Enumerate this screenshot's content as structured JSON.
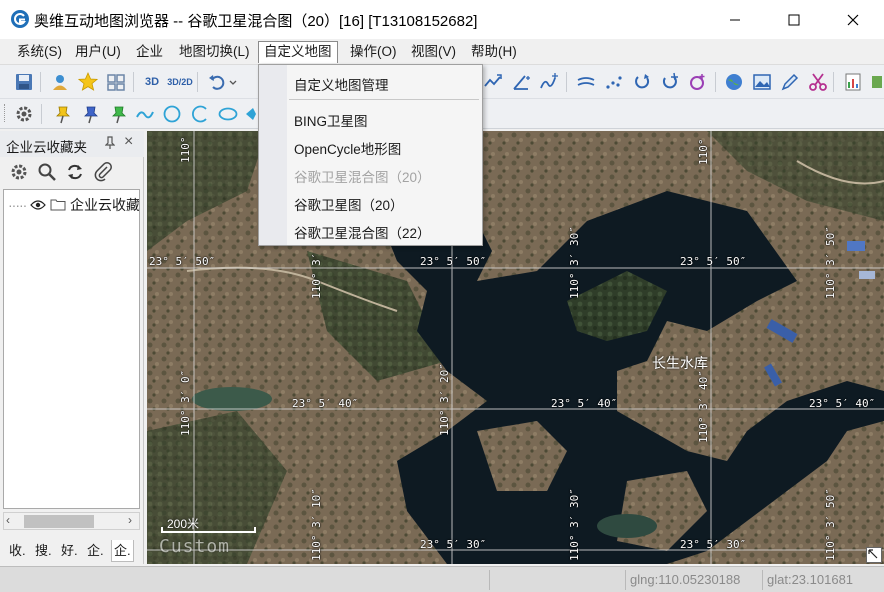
{
  "window": {
    "title": "奥维互动地图浏览器 -- 谷歌卫星混合图（20）[16] [T13108152682]"
  },
  "menu": {
    "items": [
      "系统(S)",
      "用户(U)",
      "企业",
      "地图切换(L)",
      "自定义地图",
      "操作(O)",
      "视图(V)",
      "帮助(H)"
    ],
    "active_index": 4
  },
  "dropdown": {
    "items": [
      {
        "label": "自定义地图管理",
        "enabled": true
      },
      {
        "label": "BING卫星图",
        "enabled": true
      },
      {
        "label": "OpenCycle地形图",
        "enabled": true
      },
      {
        "label": "谷歌卫星混合图（20）",
        "enabled": false
      },
      {
        "label": "谷歌卫星图（20）",
        "enabled": true
      },
      {
        "label": "谷歌卫星混合图（22）",
        "enabled": true
      }
    ]
  },
  "toolbar": {
    "btn_3d": "3D",
    "btn_3d_2d": "3D/2D"
  },
  "left_panel": {
    "title": "企业云收藏夹",
    "pin": "ᵖ",
    "close": "×",
    "tree_root": "企业云收藏夹",
    "tabs": [
      "收.",
      "搜.",
      "好.",
      "企.",
      "企."
    ],
    "selected_tab": 4
  },
  "map": {
    "place_name": "长生水库",
    "scale_label": "200米",
    "watermark": "Custom",
    "grid_labels": {
      "lat_top": "23° 5′ 50″",
      "lat_mid": "23° 5′ 40″",
      "lat_bottom": "23° 5′ 30″",
      "lng_a": "110°",
      "lng_b": "110° 3′ 0″",
      "lng_c": "110° 3′ 10″",
      "lng_d": "110° 3′ 20″",
      "lng_e": "110° 3′ 30″",
      "lng_f": "110° 3′ 40″",
      "lng_g": "110° 3′ 50″"
    }
  },
  "status": {
    "lng": "glng:110.05230188",
    "lat": "glat:23.101681"
  },
  "colors": {
    "water": "#0e1a22",
    "land": "#7a6a55",
    "vegetation": "#3c4a2e",
    "grid": "#d8d8d8"
  }
}
